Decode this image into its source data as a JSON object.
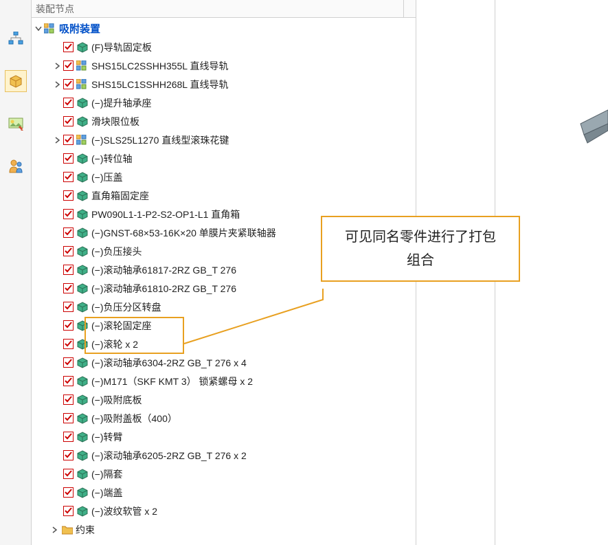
{
  "panel_header": "装配节点",
  "root_label": "吸附装置",
  "constraints_label": "约束",
  "callout_line1": "可见同名零件进行了打包",
  "callout_line2": "组合",
  "items": [
    {
      "exp": "",
      "label": "(F)导轨固定板",
      "icon": "cube"
    },
    {
      "exp": ">",
      "label": "SHS15LC2SSHH355L 直线导轨",
      "icon": "asm"
    },
    {
      "exp": ">",
      "label": "SHS15LC1SSHH268L 直线导轨",
      "icon": "asm"
    },
    {
      "exp": "",
      "label": "(−)提升轴承座",
      "icon": "cube"
    },
    {
      "exp": "",
      "label": "滑块限位板",
      "icon": "cube"
    },
    {
      "exp": ">",
      "label": "(−)SLS25L1270 直线型滚珠花键",
      "icon": "asm"
    },
    {
      "exp": "",
      "label": "(−)转位轴",
      "icon": "cube"
    },
    {
      "exp": "",
      "label": "(−)压盖",
      "icon": "cube"
    },
    {
      "exp": "",
      "label": "直角箱固定座",
      "icon": "cube"
    },
    {
      "exp": "",
      "label": "PW090L1-1-P2-S2-OP1-L1 直角箱",
      "icon": "cube"
    },
    {
      "exp": "",
      "label": "(−)GNST-68×53-16K×20 单膜片夹紧联轴器",
      "icon": "cube"
    },
    {
      "exp": "",
      "label": "(−)负压接头",
      "icon": "cube"
    },
    {
      "exp": "",
      "label": "(−)滚动轴承61817-2RZ GB_T 276",
      "icon": "cube"
    },
    {
      "exp": "",
      "label": "(−)滚动轴承61810-2RZ GB_T 276",
      "icon": "cube"
    },
    {
      "exp": "",
      "label": "(−)负压分区转盘",
      "icon": "cube"
    },
    {
      "exp": "",
      "label": "(−)滚轮固定座",
      "icon": "cube"
    },
    {
      "exp": "",
      "label": "(−)滚轮 x 2",
      "icon": "cube"
    },
    {
      "exp": "",
      "label": "(−)滚动轴承6304-2RZ GB_T 276 x 4",
      "icon": "cube"
    },
    {
      "exp": "",
      "label": "(−)M171（SKF KMT 3） 锁紧螺母 x 2",
      "icon": "cube"
    },
    {
      "exp": "",
      "label": "(−)吸附底板",
      "icon": "cube"
    },
    {
      "exp": "",
      "label": "(−)吸附盖板（400）",
      "icon": "cube"
    },
    {
      "exp": "",
      "label": "(−)转臂",
      "icon": "cube"
    },
    {
      "exp": "",
      "label": "(−)滚动轴承6205-2RZ GB_T 276 x 2",
      "icon": "cube"
    },
    {
      "exp": "",
      "label": "(−)隔套",
      "icon": "cube"
    },
    {
      "exp": "",
      "label": "(−)端盖",
      "icon": "cube"
    },
    {
      "exp": "",
      "label": "(−)波纹软管 x 2",
      "icon": "cube"
    }
  ]
}
